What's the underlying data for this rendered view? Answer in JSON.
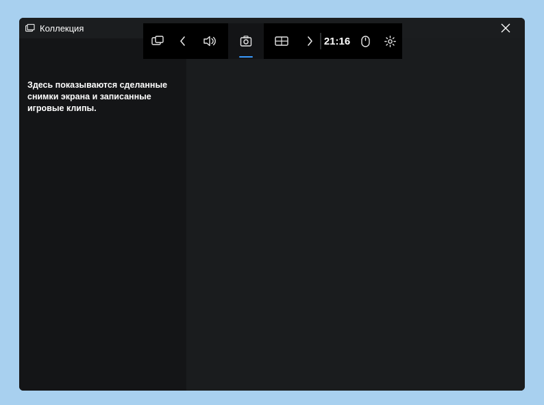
{
  "window": {
    "title": "Коллекция"
  },
  "sidebar": {
    "empty_message": "Здесь показываются сделанные снимки экрана и записанные игровые клипы."
  },
  "toolbar": {
    "clock": "21:16",
    "icons": {
      "widgets": "widgets-icon",
      "prev": "chevron-left-icon",
      "audio": "speaker-icon",
      "capture": "capture-icon",
      "perf": "performance-icon",
      "next": "chevron-right-icon",
      "mouse": "mouse-icon",
      "settings": "gear-icon"
    }
  }
}
